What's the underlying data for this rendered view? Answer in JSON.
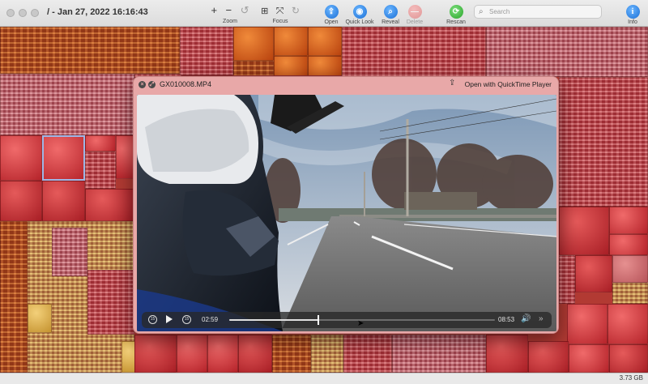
{
  "window": {
    "title": "/ - Jan 27, 2022 16:16:43"
  },
  "toolbar": {
    "zoom_label": "Zoom",
    "focus_label": "Focus",
    "open_label": "Open",
    "quicklook_label": "Quick Look",
    "reveal_label": "Reveal",
    "delete_label": "Delete",
    "rescan_label": "Rescan",
    "info_label": "Info",
    "zoom_in_glyph": "+",
    "zoom_out_glyph": "−",
    "info_glyph": "i"
  },
  "search": {
    "placeholder": "Search"
  },
  "statusbar": {
    "size": "3.73 GB"
  },
  "quicklook": {
    "filename": "GX010008.MP4",
    "open_with": "Open with QuickTime Player",
    "current_time": "02:59",
    "duration": "08:53",
    "progress": 0.336,
    "skip_back_seconds": "15",
    "skip_forward_seconds": "15"
  },
  "icons": {
    "close": "close-icon",
    "fullscreen": "fullscreen-icon",
    "share": "share-icon",
    "volume": "volume-icon",
    "more": "chevrons-right-icon",
    "zoom_in": "plus-icon",
    "zoom_out": "minus-icon",
    "rotate": "rotate-icon",
    "focus": "focus-icon",
    "open": "open-icon",
    "quick_look": "eye-icon",
    "reveal": "magnifier-icon",
    "delete": "delete-icon",
    "rescan": "rescan-icon",
    "info": "info-icon",
    "search": "search-icon"
  },
  "colors": {
    "treemap_red": "#c0454a",
    "treemap_orange": "#b9532a",
    "treemap_yellow": "#c99a52",
    "quicklook_bg": "#e8a8a8",
    "accent_blue": "#1a6fd6",
    "rescan_green": "#27a327"
  }
}
